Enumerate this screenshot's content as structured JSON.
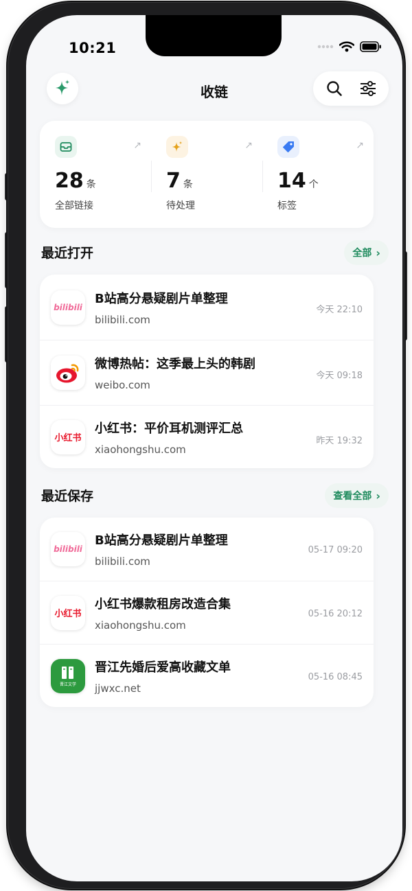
{
  "status": {
    "time": "10:21"
  },
  "header": {
    "title": "收链",
    "sparkle_icon": "sparkle-icon",
    "search_icon": "search-icon",
    "filter_icon": "filter-sliders-icon"
  },
  "stats": [
    {
      "value": "28",
      "unit": "条",
      "label": "全部链接",
      "icon": "inbox-icon",
      "color": "#1d8a5c",
      "icon_bg": "#e9f5ef"
    },
    {
      "value": "7",
      "unit": "条",
      "label": "待处理",
      "icon": "sparkle-icon",
      "color": "#e5a21c",
      "icon_bg": "#fdf3e2"
    },
    {
      "value": "14",
      "unit": "个",
      "label": "标签",
      "icon": "tag-icon",
      "color": "#3a7bf2",
      "icon_bg": "#e9f0fd"
    }
  ],
  "recent_open": {
    "title": "最近打开",
    "link": "全部",
    "items": [
      {
        "title": "B站高分悬疑剧片单整理",
        "domain": "bilibili.com",
        "time": "今天 22:10",
        "icon": "bilibili-icon"
      },
      {
        "title": "微博热帖：这季最上头的韩剧",
        "domain": "weibo.com",
        "time": "今天 09:18",
        "icon": "weibo-icon"
      },
      {
        "title": "小红书：平价耳机测评汇总",
        "domain": "xiaohongshu.com",
        "time": "昨天 19:32",
        "icon": "xiaohongshu-icon"
      }
    ]
  },
  "recent_saved": {
    "title": "最近保存",
    "link": "查看全部",
    "items": [
      {
        "title": "B站高分悬疑剧片单整理",
        "domain": "bilibili.com",
        "time": "05-17 09:20",
        "icon": "bilibili-icon"
      },
      {
        "title": "小红书爆款租房改造合集",
        "domain": "xiaohongshu.com",
        "time": "05-16 20:12",
        "icon": "xiaohongshu-icon"
      },
      {
        "title": "晋江先婚后爱高收藏文单",
        "domain": "jjwxc.net",
        "time": "05-16 08:45",
        "icon": "jjwxc-icon"
      }
    ]
  },
  "brand_text": {
    "bilibili": "bilibili",
    "xiaohongshu": "小红书",
    "jjwxc": "晋江文学"
  },
  "colors": {
    "accent": "#1d8a5c",
    "link_bg": "#eef5f2",
    "bilibili": "#f06a98",
    "xiaohongshu": "#e8192c",
    "jjwxc": "#2c9a3e",
    "weibo": "#e6162d"
  }
}
